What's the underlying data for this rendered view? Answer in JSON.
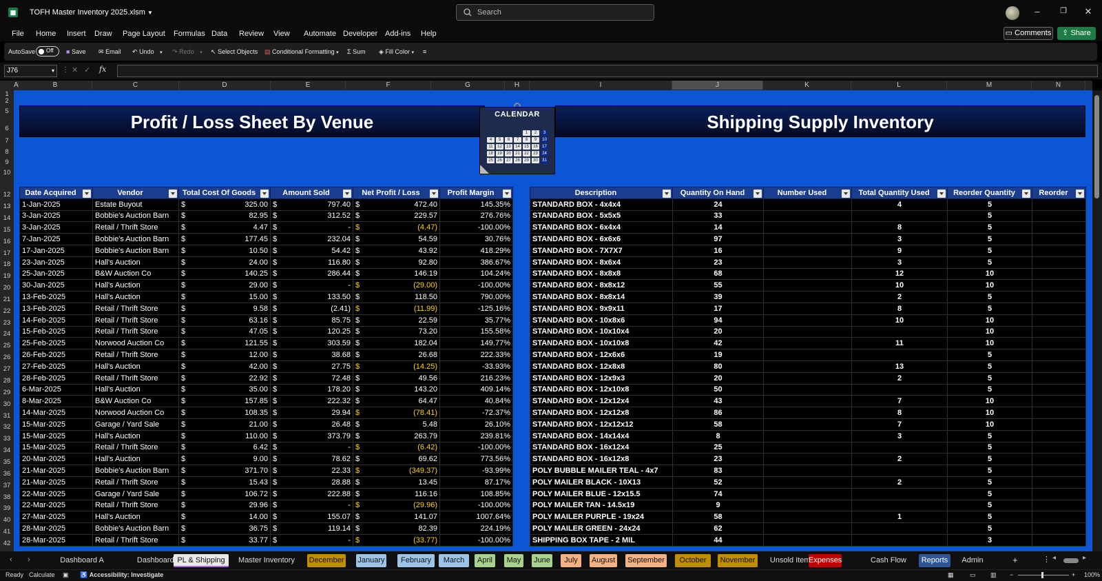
{
  "window": {
    "title": "TOFH Master Inventory 2025.xlsm",
    "search_placeholder": "Search",
    "min": "–",
    "max": "❐",
    "close": "✕"
  },
  "menu": [
    "File",
    "Home",
    "Insert",
    "Draw",
    "Page Layout",
    "Formulas",
    "Data",
    "Review",
    "View",
    "Automate",
    "Developer",
    "Add-ins",
    "Help"
  ],
  "menu_right": {
    "comments": "Comments",
    "share": "Share"
  },
  "ribbon": {
    "autosave": "AutoSave",
    "toggle": "Off",
    "save": "Save",
    "email": "Email",
    "undo": "Undo",
    "redo": "Redo",
    "select_objects": "Select Objects",
    "conditional_formatting": "Conditional Formatting",
    "sum": "Sum",
    "fill_color": "Fill Color"
  },
  "formula_bar": {
    "name_box": "J76",
    "fx": "fx",
    "content": ""
  },
  "columns": [
    "A",
    "B",
    "C",
    "D",
    "E",
    "F",
    "G",
    "H",
    "I",
    "J",
    "K",
    "L",
    "M",
    "N"
  ],
  "selected_column": "J",
  "rows": [
    "1",
    "2",
    "5",
    "6",
    "7",
    "8",
    "9",
    "10",
    "12",
    "13",
    "14",
    "15",
    "16",
    "17",
    "18",
    "19",
    "20",
    "21",
    "22",
    "23",
    "24",
    "25",
    "26",
    "27",
    "28",
    "29",
    "30",
    "31",
    "32",
    "33",
    "34",
    "35",
    "36",
    "37",
    "38",
    "39",
    "40",
    "41",
    "42"
  ],
  "left_banner": "Profit / Loss Sheet  By Venue",
  "right_banner": "Shipping Supply Inventory",
  "calendar": {
    "title": "CALENDAR",
    "days": [
      "1",
      "2",
      "3",
      "4",
      "5",
      "6",
      "7",
      "8",
      "9",
      "10",
      "11",
      "12",
      "13",
      "14",
      "15",
      "16",
      "17",
      "18",
      "19",
      "20",
      "21",
      "22",
      "23",
      "24",
      "25",
      "26",
      "27",
      "28",
      "29",
      "30",
      "31"
    ]
  },
  "pl_headers": [
    "Date Acquired",
    "Vendor",
    "Total Cost Of Goods",
    "Amount Sold",
    "Net Profit / Loss",
    "Profit Margin"
  ],
  "pl_rows": [
    [
      "1-Jan-2025",
      "Estate Buyout",
      "325.00",
      "797.40",
      "472.40",
      "145.35%"
    ],
    [
      "3-Jan-2025",
      "Bobbie's Auction Barn",
      "82.95",
      "312.52",
      "229.57",
      "276.76%"
    ],
    [
      "3-Jan-2025",
      "Retail / Thrift Store",
      "4.47",
      "-",
      "(4.47)",
      "-100.00%"
    ],
    [
      "7-Jan-2025",
      "Bobbie's Auction Barn",
      "177.45",
      "232.04",
      "54.59",
      "30.76%"
    ],
    [
      "17-Jan-2025",
      "Bobbie's Auction Barn",
      "10.50",
      "54.42",
      "43.92",
      "418.29%"
    ],
    [
      "23-Jan-2025",
      "Hall's Auction",
      "24.00",
      "116.80",
      "92.80",
      "386.67%"
    ],
    [
      "25-Jan-2025",
      "B&W Auction Co",
      "140.25",
      "286.44",
      "146.19",
      "104.24%"
    ],
    [
      "30-Jan-2025",
      "Hall's Auction",
      "29.00",
      "-",
      "(29.00)",
      "-100.00%"
    ],
    [
      "13-Feb-2025",
      "Hall's Auction",
      "15.00",
      "133.50",
      "118.50",
      "790.00%"
    ],
    [
      "13-Feb-2025",
      "Retail / Thrift Store",
      "9.58",
      "(2.41)",
      "(11.99)",
      "-125.16%"
    ],
    [
      "14-Feb-2025",
      "Retail / Thrift Store",
      "63.16",
      "85.75",
      "22.59",
      "35.77%"
    ],
    [
      "15-Feb-2025",
      "Retail / Thrift Store",
      "47.05",
      "120.25",
      "73.20",
      "155.58%"
    ],
    [
      "25-Feb-2025",
      "Norwood Auction Co",
      "121.55",
      "303.59",
      "182.04",
      "149.77%"
    ],
    [
      "26-Feb-2025",
      "Retail / Thrift Store",
      "12.00",
      "38.68",
      "26.68",
      "222.33%"
    ],
    [
      "27-Feb-2025",
      "Hall's Auction",
      "42.00",
      "27.75",
      "(14.25)",
      "-33.93%"
    ],
    [
      "28-Feb-2025",
      "Retail / Thrift Store",
      "22.92",
      "72.48",
      "49.56",
      "216.23%"
    ],
    [
      "6-Mar-2025",
      "Hall's Auction",
      "35.00",
      "178.20",
      "143.20",
      "409.14%"
    ],
    [
      "8-Mar-2025",
      "B&W Auction Co",
      "157.85",
      "222.32",
      "64.47",
      "40.84%"
    ],
    [
      "14-Mar-2025",
      "Norwood Auction Co",
      "108.35",
      "29.94",
      "(78.41)",
      "-72.37%"
    ],
    [
      "15-Mar-2025",
      "Garage / Yard Sale",
      "21.00",
      "26.48",
      "5.48",
      "26.10%"
    ],
    [
      "15-Mar-2025",
      "Hall's Auction",
      "110.00",
      "373.79",
      "263.79",
      "239.81%"
    ],
    [
      "15-Mar-2025",
      "Retail / Thrift Store",
      "6.42",
      "-",
      "(6.42)",
      "-100.00%"
    ],
    [
      "20-Mar-2025",
      "Hall's Auction",
      "9.00",
      "78.62",
      "69.62",
      "773.56%"
    ],
    [
      "21-Mar-2025",
      "Bobbie's Auction Barn",
      "371.70",
      "22.33",
      "(349.37)",
      "-93.99%"
    ],
    [
      "21-Mar-2025",
      "Retail / Thrift Store",
      "15.43",
      "28.88",
      "13.45",
      "87.17%"
    ],
    [
      "22-Mar-2025",
      "Garage / Yard Sale",
      "106.72",
      "222.88",
      "116.16",
      "108.85%"
    ],
    [
      "22-Mar-2025",
      "Retail / Thrift Store",
      "29.96",
      "-",
      "(29.96)",
      "-100.00%"
    ],
    [
      "27-Mar-2025",
      "Hall's Auction",
      "14.00",
      "155.07",
      "141.07",
      "1007.64%"
    ],
    [
      "28-Mar-2025",
      "Bobbie's Auction Barn",
      "36.75",
      "119.14",
      "82.39",
      "224.19%"
    ],
    [
      "28-Mar-2025",
      "Retail / Thrift Store",
      "33.77",
      "-",
      "(33.77)",
      "-100.00%"
    ]
  ],
  "currency_symbol": "$",
  "inv_headers": [
    "Description",
    "Quantity On Hand",
    "Number Used",
    "Total Quantity Used",
    "Reorder Quantity",
    "Reorder"
  ],
  "inv_rows": [
    [
      "STANDARD BOX - 4x4x4",
      "24",
      "",
      "4",
      "5",
      ""
    ],
    [
      "STANDARD BOX - 5x5x5",
      "33",
      "",
      "",
      "5",
      ""
    ],
    [
      "STANDARD BOX - 6x4x4",
      "14",
      "",
      "8",
      "5",
      ""
    ],
    [
      "STANDARD BOX - 6x6x6",
      "97",
      "",
      "3",
      "5",
      ""
    ],
    [
      "STANDARD BOX - 7X7X7",
      "16",
      "",
      "9",
      "5",
      ""
    ],
    [
      "STANDARD BOX - 8x6x4",
      "23",
      "",
      "3",
      "5",
      ""
    ],
    [
      "STANDARD BOX - 8x8x8",
      "68",
      "",
      "12",
      "10",
      ""
    ],
    [
      "STANDARD BOX - 8x8x12",
      "55",
      "",
      "10",
      "10",
      ""
    ],
    [
      "STANDARD BOX - 8x8x14",
      "39",
      "",
      "2",
      "5",
      ""
    ],
    [
      "STANDARD BOX - 9x9x11",
      "17",
      "",
      "8",
      "5",
      ""
    ],
    [
      "STANDARD BOX - 10x8x6",
      "94",
      "",
      "10",
      "10",
      ""
    ],
    [
      "STANDARD BOX - 10x10x4",
      "20",
      "",
      "",
      "10",
      ""
    ],
    [
      "STANDARD BOX - 10x10x8",
      "42",
      "",
      "11",
      "10",
      ""
    ],
    [
      "STANDARD BOX - 12x6x6",
      "19",
      "",
      "",
      "5",
      ""
    ],
    [
      "STANDARD BOX - 12x8x8",
      "80",
      "",
      "13",
      "5",
      ""
    ],
    [
      "STANDARD BOX - 12x9x3",
      "20",
      "",
      "2",
      "5",
      ""
    ],
    [
      "STANDARD BOX - 12x10x8",
      "50",
      "",
      "",
      "5",
      ""
    ],
    [
      "STANDARD BOX - 12x12x4",
      "43",
      "",
      "7",
      "10",
      ""
    ],
    [
      "STANDARD BOX - 12x12x8",
      "86",
      "",
      "8",
      "10",
      ""
    ],
    [
      "STANDARD BOX - 12x12x12",
      "58",
      "",
      "7",
      "10",
      ""
    ],
    [
      "STANDARD BOX - 14x14x4",
      "8",
      "",
      "3",
      "5",
      ""
    ],
    [
      "STANDARD BOX - 16x12x4",
      "25",
      "",
      "",
      "5",
      ""
    ],
    [
      "STANDARD BOX - 16x12x8",
      "23",
      "",
      "2",
      "5",
      ""
    ],
    [
      "POLY BUBBLE MAILER TEAL - 4x7",
      "83",
      "",
      "",
      "5",
      ""
    ],
    [
      "POLY MAILER BLACK - 10X13",
      "52",
      "",
      "2",
      "5",
      ""
    ],
    [
      "POLY MAILER BLUE - 12x15.5",
      "74",
      "",
      "",
      "5",
      ""
    ],
    [
      "POLY MAILER  TAN - 14.5x19",
      "9",
      "",
      "",
      "5",
      ""
    ],
    [
      "POLY MAILER PURPLE - 19x24",
      "58",
      "",
      "1",
      "5",
      ""
    ],
    [
      "POLY MAILER GREEN - 24x24",
      "62",
      "",
      "",
      "5",
      ""
    ],
    [
      "SHIPPING BOX TAPE - 2 MIL",
      "44",
      "",
      "",
      "3",
      ""
    ]
  ],
  "tabs": [
    {
      "label": "Dashboard A",
      "bg": "",
      "fg": "#ddd"
    },
    {
      "label": "Dashboard B",
      "bg": "",
      "fg": "#ddd"
    },
    {
      "label": "PL & Shipping",
      "bg": "#e9e9e9",
      "fg": "#111"
    },
    {
      "label": "Master Inventory",
      "bg": "",
      "fg": "#ddd"
    },
    {
      "label": "December",
      "bg": "#bf8f00",
      "fg": "#111"
    },
    {
      "label": "January",
      "bg": "#9dc3e6",
      "fg": "#111"
    },
    {
      "label": "February",
      "bg": "#9dc3e6",
      "fg": "#111"
    },
    {
      "label": "March",
      "bg": "#9dc3e6",
      "fg": "#111"
    },
    {
      "label": "April",
      "bg": "#a9d18e",
      "fg": "#111"
    },
    {
      "label": "May",
      "bg": "#a9d18e",
      "fg": "#111"
    },
    {
      "label": "June",
      "bg": "#a9d18e",
      "fg": "#111"
    },
    {
      "label": "July",
      "bg": "#f4b183",
      "fg": "#111"
    },
    {
      "label": "August",
      "bg": "#f4b183",
      "fg": "#111"
    },
    {
      "label": "September",
      "bg": "#f4b183",
      "fg": "#111"
    },
    {
      "label": "October",
      "bg": "#bf8f00",
      "fg": "#111"
    },
    {
      "label": "November",
      "bg": "#bf8f00",
      "fg": "#111"
    },
    {
      "label": "Unsold Items",
      "bg": "",
      "fg": "#ddd"
    },
    {
      "label": "Expenses",
      "bg": "#c00000",
      "fg": "#fff"
    },
    {
      "label": "Cash Flow",
      "bg": "",
      "fg": "#ddd"
    },
    {
      "label": "Reports",
      "bg": "#2f5597",
      "fg": "#fff"
    },
    {
      "label": "Admin",
      "bg": "",
      "fg": "#ddd"
    }
  ],
  "status": {
    "ready": "Ready",
    "calculate": "Calculate",
    "accessibility": "Accessibility: Investigate",
    "zoom": "100%"
  }
}
